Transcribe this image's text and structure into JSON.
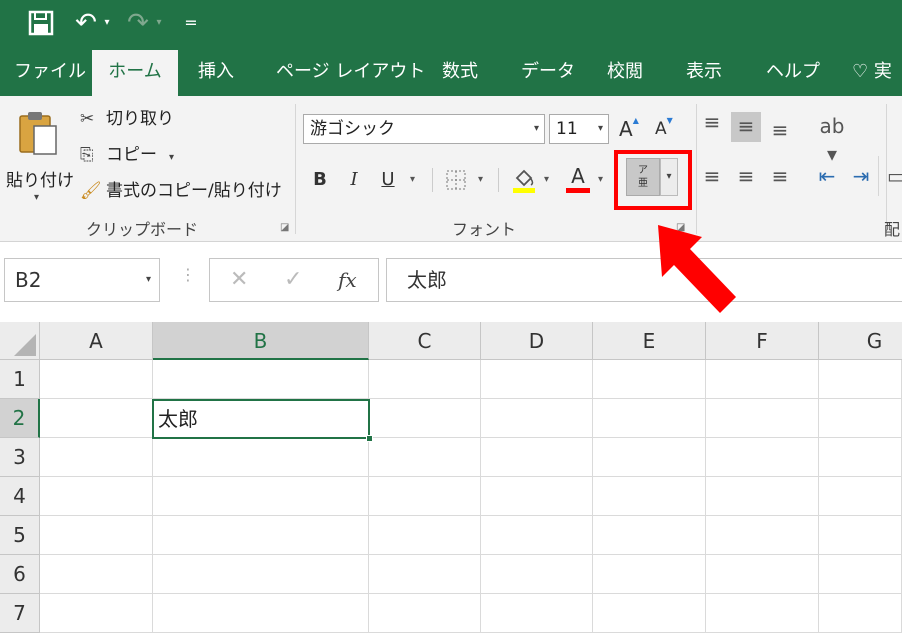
{
  "qat": {
    "save_icon": "💾",
    "undo_icon": "↶",
    "redo_icon": "↷",
    "dropdown_glyph": "▾",
    "customize_icon": "="
  },
  "ribbon_tabs": [
    {
      "label": "ファイル"
    },
    {
      "label": "ホーム",
      "active": true
    },
    {
      "label": "挿入"
    },
    {
      "label": "ページ レイアウト"
    },
    {
      "label": "数式"
    },
    {
      "label": "データ"
    },
    {
      "label": "校閲"
    },
    {
      "label": "表示"
    },
    {
      "label": "ヘルプ"
    },
    {
      "label": "実"
    }
  ],
  "clipboard": {
    "paste_label": "貼り付け",
    "cut_label": "切り取り",
    "copy_label": "コピー",
    "format_painter_label": "書式のコピー/貼り付け",
    "group_label": "クリップボード"
  },
  "font": {
    "font_name": "游ゴシック",
    "font_size": "11",
    "grow_label": "A",
    "shrink_label": "A",
    "bold_label": "B",
    "italic_label": "I",
    "underline_label": "U",
    "font_color_letter": "A",
    "phonetic_top": "ア",
    "phonetic_bottom": "亜",
    "group_label": "フォント"
  },
  "alignment": {
    "group_label_partial": "配"
  },
  "formula_bar": {
    "name_box": "B2",
    "cancel_glyph": "✕",
    "enter_glyph": "✓",
    "fx_label": "fx",
    "formula": "太郎"
  },
  "grid": {
    "columns": [
      "A",
      "B",
      "C",
      "D",
      "E",
      "F",
      "G"
    ],
    "rows": [
      "1",
      "2",
      "3",
      "4",
      "5",
      "6",
      "7"
    ],
    "selected_column": "B",
    "selected_row": "2",
    "active_cell_value": "太郎"
  },
  "colors": {
    "excel_green": "#217346",
    "annotation_red": "#ff0000",
    "highlight_yellow": "#ffff00",
    "font_red": "#ff0000"
  }
}
